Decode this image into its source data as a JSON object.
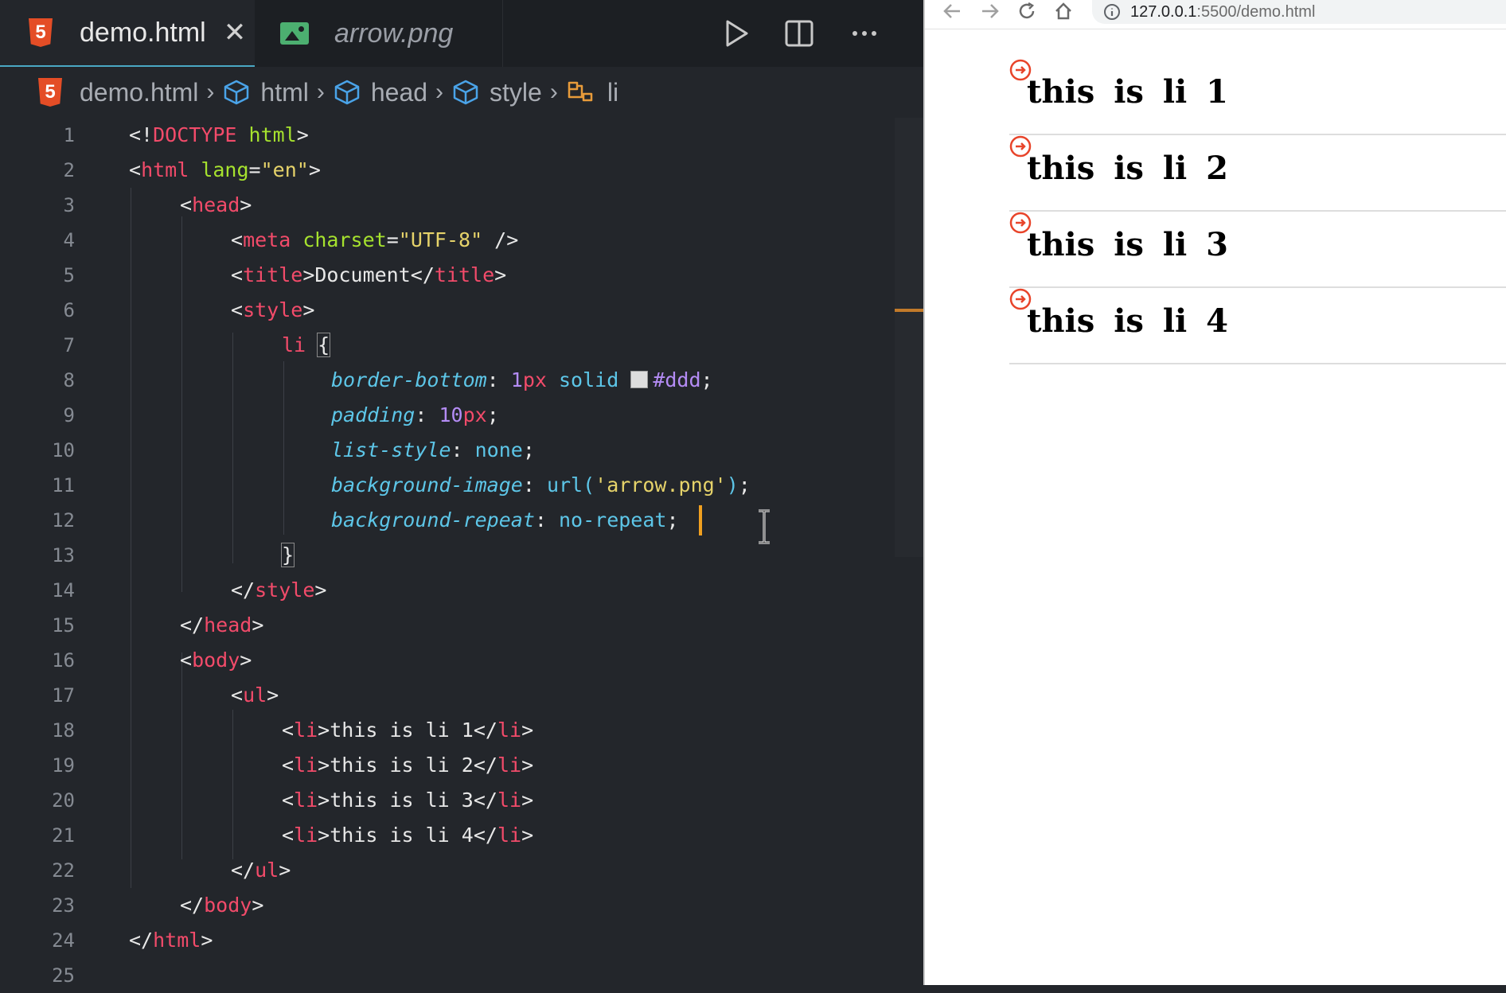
{
  "editor": {
    "tabs": [
      {
        "label": "demo.html",
        "icon": "html5-icon",
        "active": true
      },
      {
        "label": "arrow.png",
        "icon": "image-icon",
        "active": false
      }
    ],
    "toolbar": {
      "run": "play-icon",
      "split": "split-editor-icon",
      "more": "more-icon"
    },
    "breadcrumb": [
      {
        "label": "demo.html",
        "icon": "html5-icon"
      },
      {
        "label": "html",
        "icon": "cube-icon"
      },
      {
        "label": "head",
        "icon": "cube-icon"
      },
      {
        "label": "style",
        "icon": "cube-icon"
      },
      {
        "label": "li",
        "icon": "selector-icon"
      }
    ],
    "line_numbers": [
      "1",
      "2",
      "3",
      "4",
      "5",
      "6",
      "7",
      "8",
      "9",
      "10",
      "11",
      "12",
      "13",
      "14",
      "15",
      "16",
      "17",
      "18",
      "19",
      "20",
      "21",
      "22",
      "23",
      "24",
      "25"
    ],
    "code": {
      "l1a": "<!",
      "l1b": "DOCTYPE",
      "l1c": " html",
      "l1d": ">",
      "l2a": "<",
      "l2b": "html",
      "l2c": " lang",
      "l2d": "=",
      "l2e": "\"en\"",
      "l2f": ">",
      "l3a": "<",
      "l3b": "head",
      "l3c": ">",
      "l4a": "<",
      "l4b": "meta",
      "l4c": " charset",
      "l4d": "=",
      "l4e": "\"UTF-8\"",
      "l4f": " />",
      "l5a": "<",
      "l5b": "title",
      "l5c": ">Document</",
      "l5d": "title",
      "l5e": ">",
      "l6a": "<",
      "l6b": "style",
      "l6c": ">",
      "l7a": "li",
      "l7b": " ",
      "l7c": "{",
      "l8a": "border-bottom",
      "l8b": ": ",
      "l8c": "1",
      "l8d": "px",
      "l8e": " solid ",
      "l8f": "#ddd",
      "l8g": ";",
      "l9a": "padding",
      "l9b": ": ",
      "l9c": "10",
      "l9d": "px",
      "l9e": ";",
      "l10a": "list-style",
      "l10b": ": ",
      "l10c": "none",
      "l10d": ";",
      "l11a": "background-image",
      "l11b": ": ",
      "l11c": "url(",
      "l11d": "'arrow.png'",
      "l11e": ")",
      "l11f": ";",
      "l12a": "background-repeat",
      "l12b": ": ",
      "l12c": "no-repeat",
      "l12d": ";",
      "l13a": "}",
      "l14a": "</",
      "l14b": "style",
      "l14c": ">",
      "l15a": "</",
      "l15b": "head",
      "l15c": ">",
      "l16a": "<",
      "l16b": "body",
      "l16c": ">",
      "l17a": "<",
      "l17b": "ul",
      "l17c": ">",
      "l18a": "<",
      "l18b": "li",
      "l18c": ">this is li 1</",
      "l18d": "li",
      "l18e": ">",
      "l19a": "<",
      "l19b": "li",
      "l19c": ">this is li 2</",
      "l19d": "li",
      "l19e": ">",
      "l20a": "<",
      "l20b": "li",
      "l20c": ">this is li 3</",
      "l20d": "li",
      "l20e": ">",
      "l21a": "<",
      "l21b": "li",
      "l21c": ">this is li 4</",
      "l21d": "li",
      "l21e": ">",
      "l22a": "</",
      "l22b": "ul",
      "l22c": ">",
      "l23a": "</",
      "l23b": "body",
      "l23c": ">",
      "l24a": "</",
      "l24b": "html",
      "l24c": ">"
    },
    "colors": {
      "tag": "#f24b6a",
      "attr": "#a6e22e",
      "string": "#e6d36a",
      "property": "#5dc6e8",
      "number": "#b48cf5",
      "cursor": "#f0a020"
    }
  },
  "browser": {
    "nav": {
      "back": "arrow-left-icon",
      "forward": "arrow-right-icon",
      "reload": "reload-icon",
      "home": "home-icon"
    },
    "address": {
      "host": "127.0.0.1",
      "path": ":5500/demo.html",
      "icon": "info-icon"
    },
    "items": [
      "this is li 1",
      "this is li 2",
      "this is li 3",
      "this is li 4"
    ],
    "border_color": "#dddddd",
    "arrow_color": "#e8442a"
  }
}
